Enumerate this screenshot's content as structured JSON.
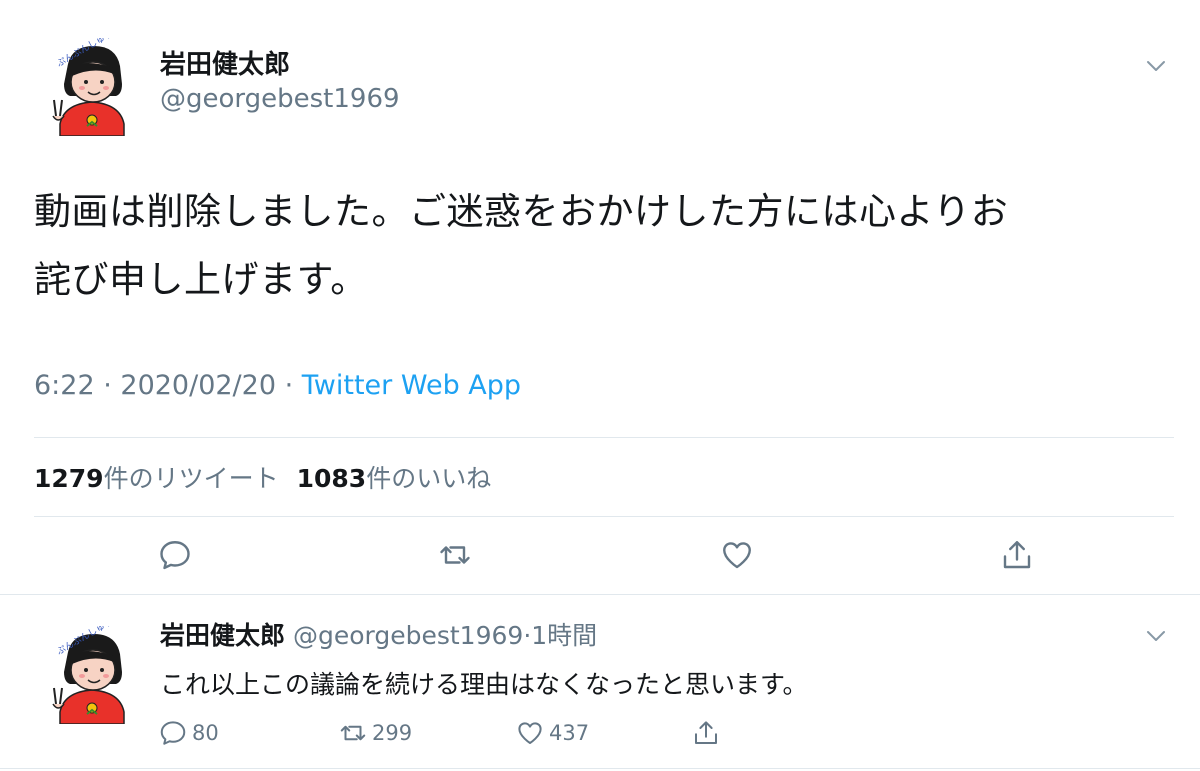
{
  "main_tweet": {
    "display_name": "岩田健太郎",
    "handle": "@georgebest1969",
    "text_line1": "動画は削除しました。ご迷惑をおかけした方には心よりお",
    "text_line2": "詫び申し上げます。",
    "time": "6:22",
    "sep1": " · ",
    "date": "2020/02/20",
    "sep2": " · ",
    "source": "Twitter Web App",
    "retweet_count": "1279",
    "retweet_label": "件のリツイート",
    "like_count": "1083",
    "like_label": "件のいいね"
  },
  "reply_tweet": {
    "display_name": "岩田健太郎",
    "handle": "@georgebest1969",
    "dot": "·",
    "time": "1時間",
    "text": "これ以上この議論を続ける理由はなくなったと思います。",
    "reply_count": "80",
    "retweet_count": "299",
    "like_count": "437"
  },
  "icons": {
    "chevron": "chevron-down-icon",
    "reply": "reply-icon",
    "retweet": "retweet-icon",
    "like": "heart-icon",
    "share": "share-icon"
  },
  "colors": {
    "text": "#14171a",
    "secondary": "#657786",
    "link": "#1da1f2",
    "divider": "#e1e8ed",
    "avatar_shirt": "#e8312a"
  }
}
